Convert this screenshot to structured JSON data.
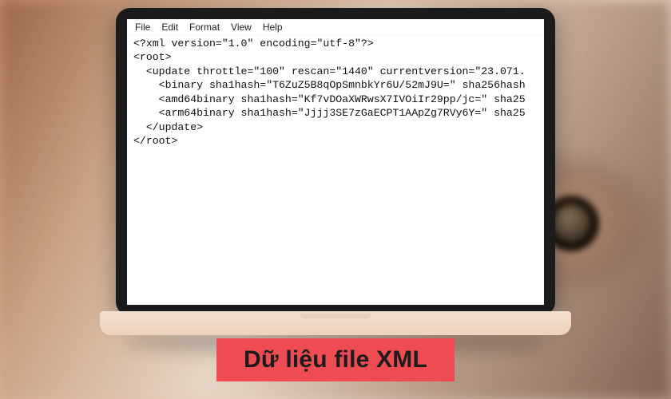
{
  "menubar": {
    "file": "File",
    "edit": "Edit",
    "format": "Format",
    "view": "View",
    "help": "Help"
  },
  "code": {
    "line1": "<?xml version=\"1.0\" encoding=\"utf-8\"?>",
    "line2": "<root>",
    "line3": "  <update throttle=\"100\" rescan=\"1440\" currentversion=\"23.071.",
    "line4": "    <binary sha1hash=\"T6ZuZ5B8qOpSmnbkYr6U/52mJ9U=\" sha256hash",
    "line5": "    <amd64binary sha1hash=\"Kf7vDOaXWRwsX7IVOiIr29pp/jc=\" sha25",
    "line6": "    <arm64binary sha1hash=\"Jjjj3SE7zGaECPT1AApZg7RVy6Y=\" sha25",
    "line7": "  </update>",
    "line8": "</root>"
  },
  "caption": {
    "text": "Dữ liệu file XML"
  },
  "colors": {
    "caption_bg": "#ee4b52",
    "caption_fg": "#1c1c1c",
    "bezel": "#1b1b1b"
  }
}
